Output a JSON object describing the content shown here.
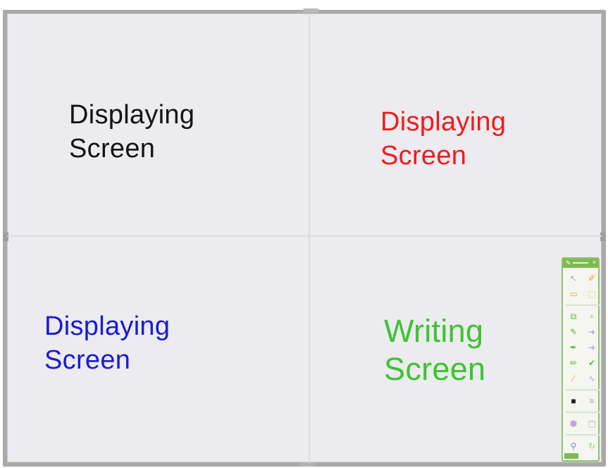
{
  "quadrants": {
    "top_left": {
      "line1": "Displaying",
      "line2": "Screen",
      "color": "#141414"
    },
    "top_right": {
      "line1": "Displaying",
      "line2": "Screen",
      "color": "#ee1c1c"
    },
    "bottom_left": {
      "line1": "Displaying",
      "line2": "Screen",
      "color": "#1a1ad2"
    },
    "bottom_right": {
      "line1": "Writing",
      "line2": "Screen",
      "color": "#3ec330"
    }
  },
  "toolbar": {
    "accent": "#7dbb4f",
    "icons": [
      "pointer-icon",
      "highlighter-icon",
      "select-box-icon",
      "rectangle-select-icon",
      "screen-capture-icon",
      "add-icon",
      "pen-icon",
      "arrow-icon",
      "brush-icon",
      "arrow-right-icon",
      "marker-icon",
      "check-icon",
      "eraser-icon",
      "curve-icon",
      "color-swatch-icon",
      "line-width-icon",
      "stamp-icon",
      "frame-icon",
      "zoom-icon",
      "refresh-icon"
    ]
  }
}
